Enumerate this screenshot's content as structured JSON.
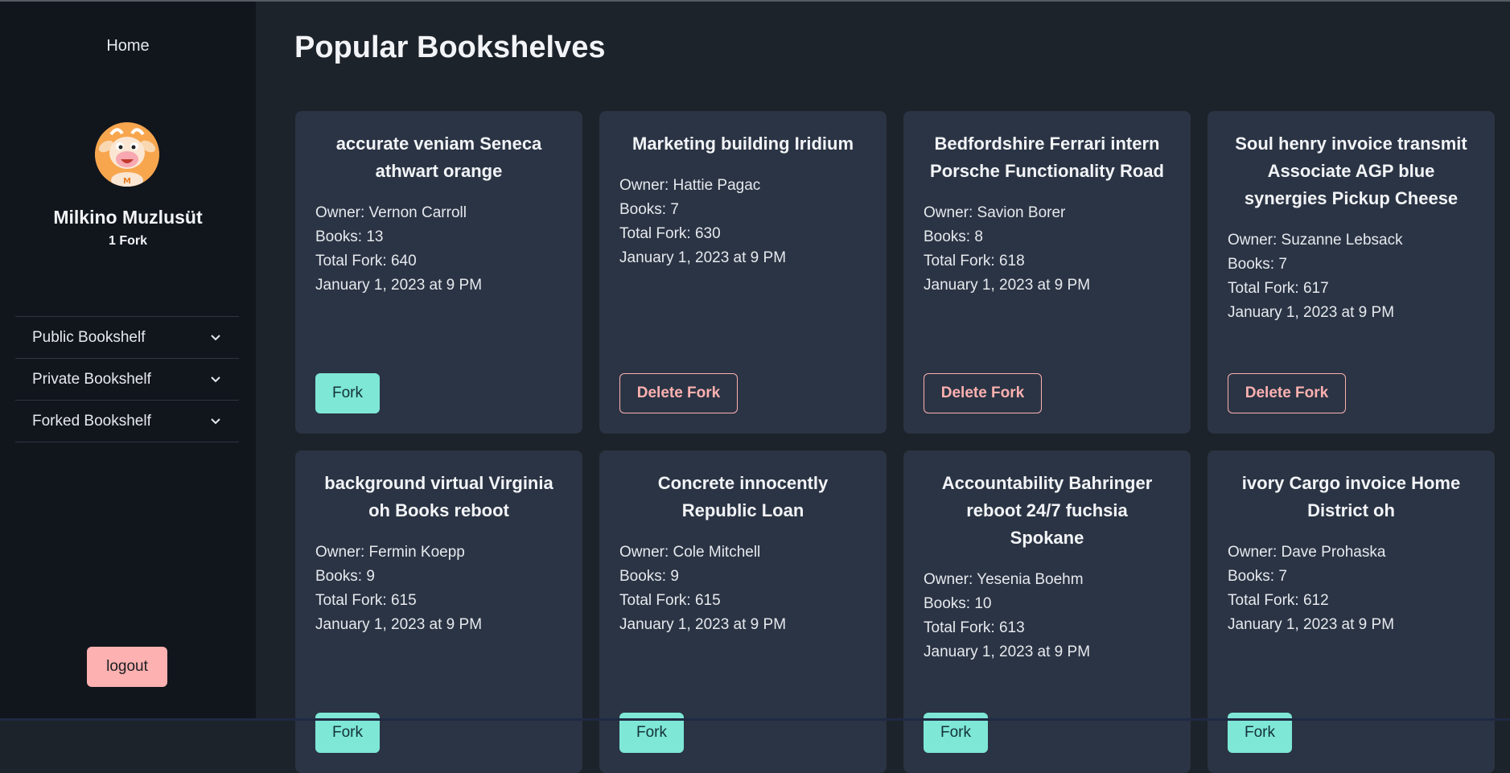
{
  "nav": {
    "home_label": "Home"
  },
  "user": {
    "name": "Milkino Muzlusüt",
    "forks": "1 Fork"
  },
  "menu": [
    {
      "label": "Public Bookshelf"
    },
    {
      "label": "Private Bookshelf"
    },
    {
      "label": "Forked Bookshelf"
    }
  ],
  "logout_label": "logout",
  "page_title": "Popular Bookshelves",
  "colors": {
    "fork_button": "#7ee7d6",
    "delete_button": "#fdb1b0",
    "card_background": "#2b3444",
    "sidebar_background": "#11161d"
  },
  "cards": [
    {
      "title": "accurate veniam Seneca athwart orange",
      "owner": "Owner: Vernon Carroll",
      "books": "Books: 13",
      "total_fork": "Total Fork: 640",
      "date": "January 1, 2023 at 9 PM",
      "button": "Fork",
      "button_type": "fork"
    },
    {
      "title": "Marketing building Iridium",
      "owner": "Owner: Hattie Pagac",
      "books": "Books: 7",
      "total_fork": "Total Fork: 630",
      "date": "January 1, 2023 at 9 PM",
      "button": "Delete Fork",
      "button_type": "delete"
    },
    {
      "title": "Bedfordshire Ferrari intern Porsche Functionality Road",
      "owner": "Owner: Savion Borer",
      "books": "Books: 8",
      "total_fork": "Total Fork: 618",
      "date": "January 1, 2023 at 9 PM",
      "button": "Delete Fork",
      "button_type": "delete"
    },
    {
      "title": "Soul henry invoice transmit Associate AGP blue synergies Pickup Cheese",
      "owner": "Owner: Suzanne Lebsack",
      "books": "Books: 7",
      "total_fork": "Total Fork: 617",
      "date": "January 1, 2023 at 9 PM",
      "button": "Delete Fork",
      "button_type": "delete"
    },
    {
      "title": "background virtual Virginia oh Books reboot",
      "owner": "Owner: Fermin Koepp",
      "books": "Books: 9",
      "total_fork": "Total Fork: 615",
      "date": "January 1, 2023 at 9 PM",
      "button": "Fork",
      "button_type": "fork"
    },
    {
      "title": "Concrete innocently Republic Loan",
      "owner": "Owner: Cole Mitchell",
      "books": "Books: 9",
      "total_fork": "Total Fork: 615",
      "date": "January 1, 2023 at 9 PM",
      "button": "Fork",
      "button_type": "fork"
    },
    {
      "title": "Accountability Bahringer reboot 24/7 fuchsia Spokane",
      "owner": "Owner: Yesenia Boehm",
      "books": "Books: 10",
      "total_fork": "Total Fork: 613",
      "date": "January 1, 2023 at 9 PM",
      "button": "Fork",
      "button_type": "fork"
    },
    {
      "title": "ivory Cargo invoice Home District oh",
      "owner": "Owner: Dave Prohaska",
      "books": "Books: 7",
      "total_fork": "Total Fork: 612",
      "date": "January 1, 2023 at 9 PM",
      "button": "Fork",
      "button_type": "fork"
    }
  ]
}
